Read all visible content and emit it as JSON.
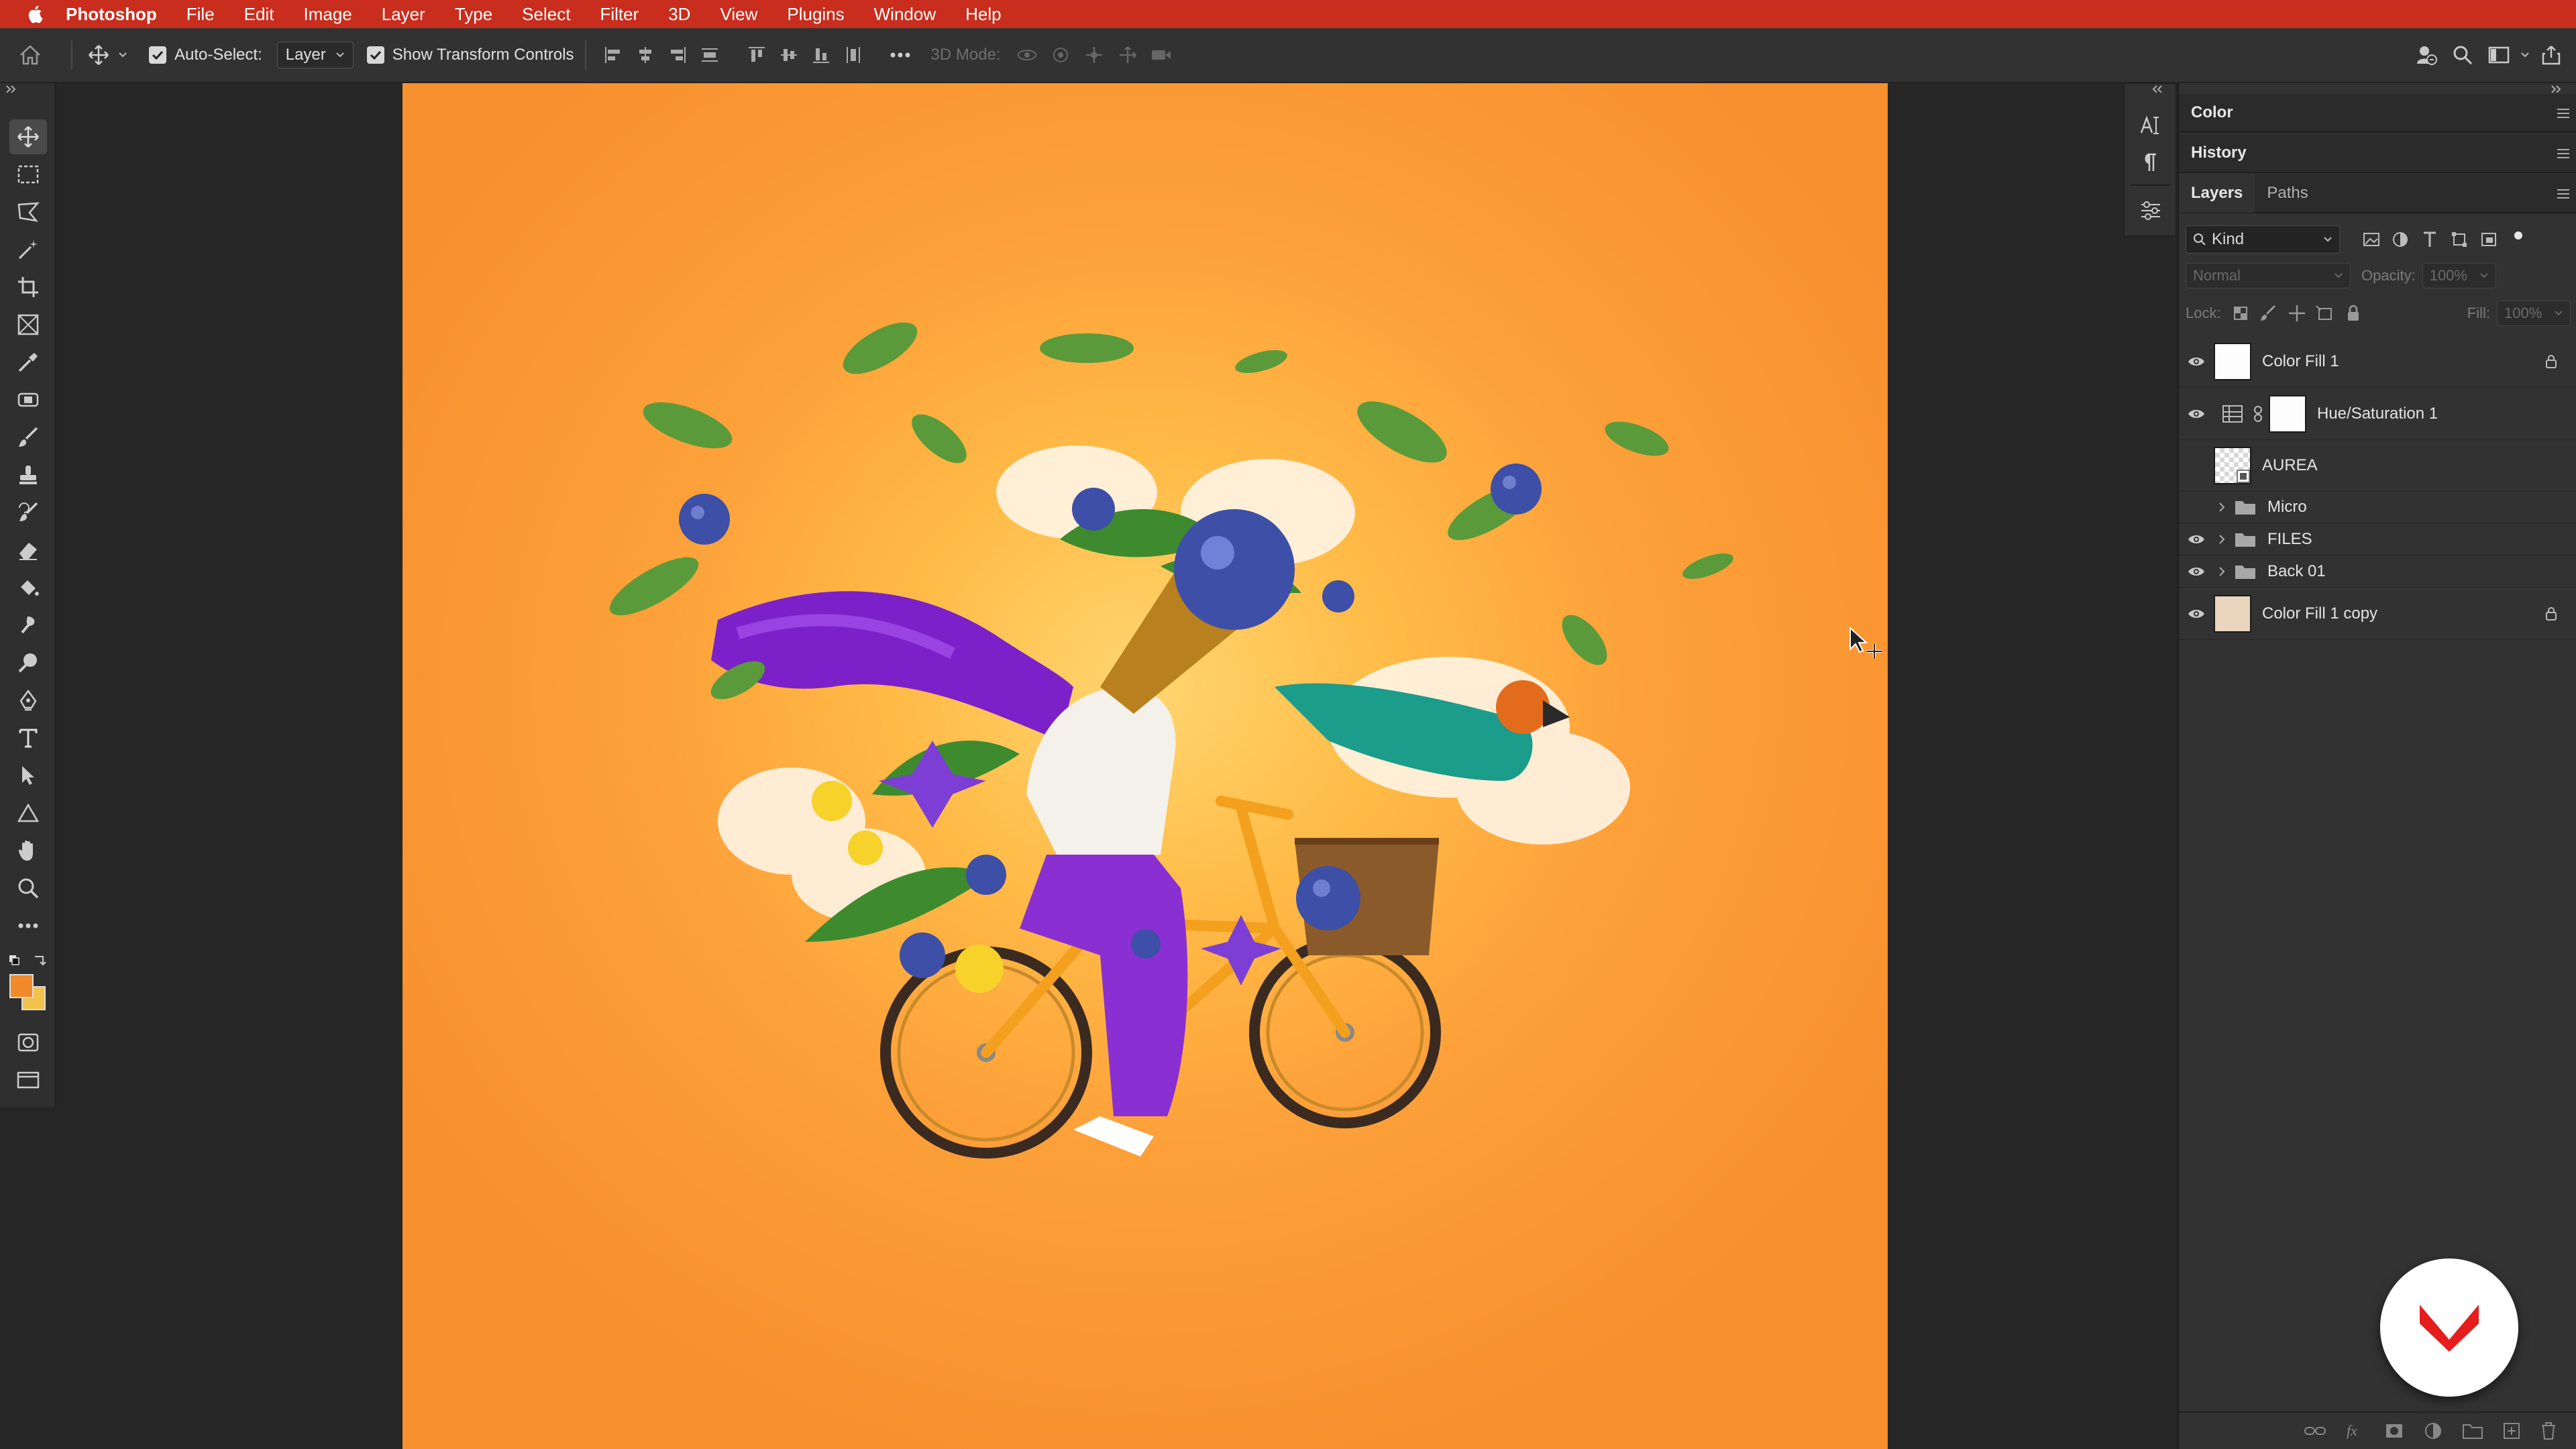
{
  "menubar": {
    "app_name": "Photoshop",
    "items": [
      "File",
      "Edit",
      "Image",
      "Layer",
      "Type",
      "Select",
      "Filter",
      "3D",
      "View",
      "Plugins",
      "Window",
      "Help"
    ]
  },
  "options": {
    "auto_select_label": "Auto-Select:",
    "auto_select_value": "Layer",
    "show_transform_label": "Show Transform Controls",
    "mode_3d_label": "3D Mode:"
  },
  "colors": {
    "foreground": "#f08a2a",
    "background": "#f2c24a",
    "accent": "#c92d1d"
  },
  "panels": {
    "color_tab": "Color",
    "history_tab": "History",
    "layers_tab": "Layers",
    "paths_tab": "Paths",
    "kind_label": "Kind",
    "blend_mode": "Normal",
    "opacity_label": "Opacity:",
    "opacity_value": "100%",
    "lock_label": "Lock:",
    "fill_label": "Fill:",
    "fill_value": "100%"
  },
  "layers": [
    {
      "name": "Color Fill 1",
      "visible": true,
      "locked": true,
      "type": "fill"
    },
    {
      "name": "Hue/Saturation 1",
      "visible": true,
      "locked": false,
      "type": "adjustment"
    },
    {
      "name": "AUREA",
      "visible": false,
      "locked": false,
      "type": "smart-object"
    },
    {
      "name": "Micro",
      "visible": false,
      "locked": false,
      "type": "group"
    },
    {
      "name": "FILES",
      "visible": true,
      "locked": false,
      "type": "group"
    },
    {
      "name": "Back 01",
      "visible": true,
      "locked": false,
      "type": "group"
    },
    {
      "name": "Color Fill 1 copy",
      "visible": true,
      "locked": true,
      "type": "fill"
    }
  ]
}
